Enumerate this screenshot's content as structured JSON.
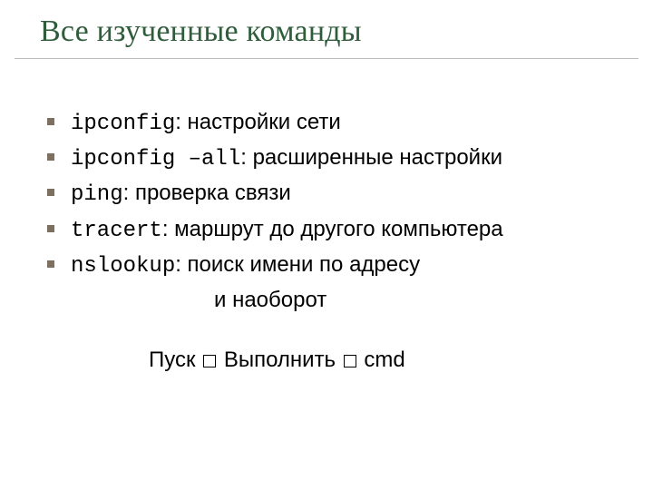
{
  "title": "Все изученные команды",
  "items": [
    {
      "cmd": "ipconfig",
      "desc": ": настройки сети"
    },
    {
      "cmd": "ipconfig –all",
      "desc": ": расширенные настройки"
    },
    {
      "cmd": "ping",
      "desc": ": проверка связи"
    },
    {
      "cmd": "tracert",
      "desc": ": маршрут до другого компьютера"
    },
    {
      "cmd": "nslookup",
      "desc": ": поиск имени по адресу"
    }
  ],
  "continuation": "и наоборот",
  "launch": {
    "a": "Пуск ",
    "b": " Выполнить ",
    "c": " cmd"
  }
}
